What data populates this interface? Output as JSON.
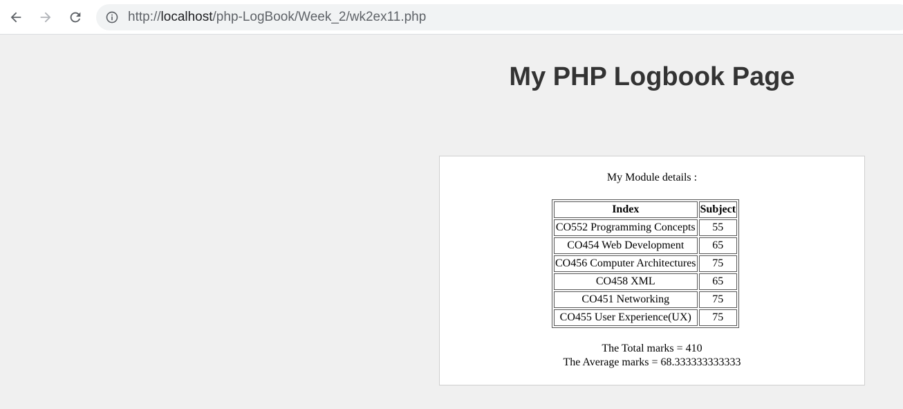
{
  "browser": {
    "url_prefix": "http://",
    "url_host": "localhost",
    "url_path": "/php-LogBook/Week_2/wk2ex11.php",
    "icons": [
      "back-arrow-icon",
      "forward-arrow-icon",
      "reload-icon",
      "info-icon"
    ]
  },
  "page": {
    "title": "My PHP Logbook Page"
  },
  "module": {
    "heading": "My Module details :",
    "columns": [
      "Index",
      "Subject"
    ],
    "rows": [
      {
        "index": "CO552 Programming Concepts",
        "subject": "55"
      },
      {
        "index": "CO454 Web Development",
        "subject": "65"
      },
      {
        "index": "CO456 Computer Architectures",
        "subject": "75"
      },
      {
        "index": "CO458 XML",
        "subject": "65"
      },
      {
        "index": "CO451 Networking",
        "subject": "75"
      },
      {
        "index": "CO455 User Experience(UX)",
        "subject": "75"
      }
    ],
    "total_text": "The Total marks = 410",
    "average_text": "The Average marks = 68.333333333333"
  },
  "colors": {
    "page_background": "#f0f0f0",
    "panel_background": "#ffffff",
    "title_color": "#333333"
  }
}
